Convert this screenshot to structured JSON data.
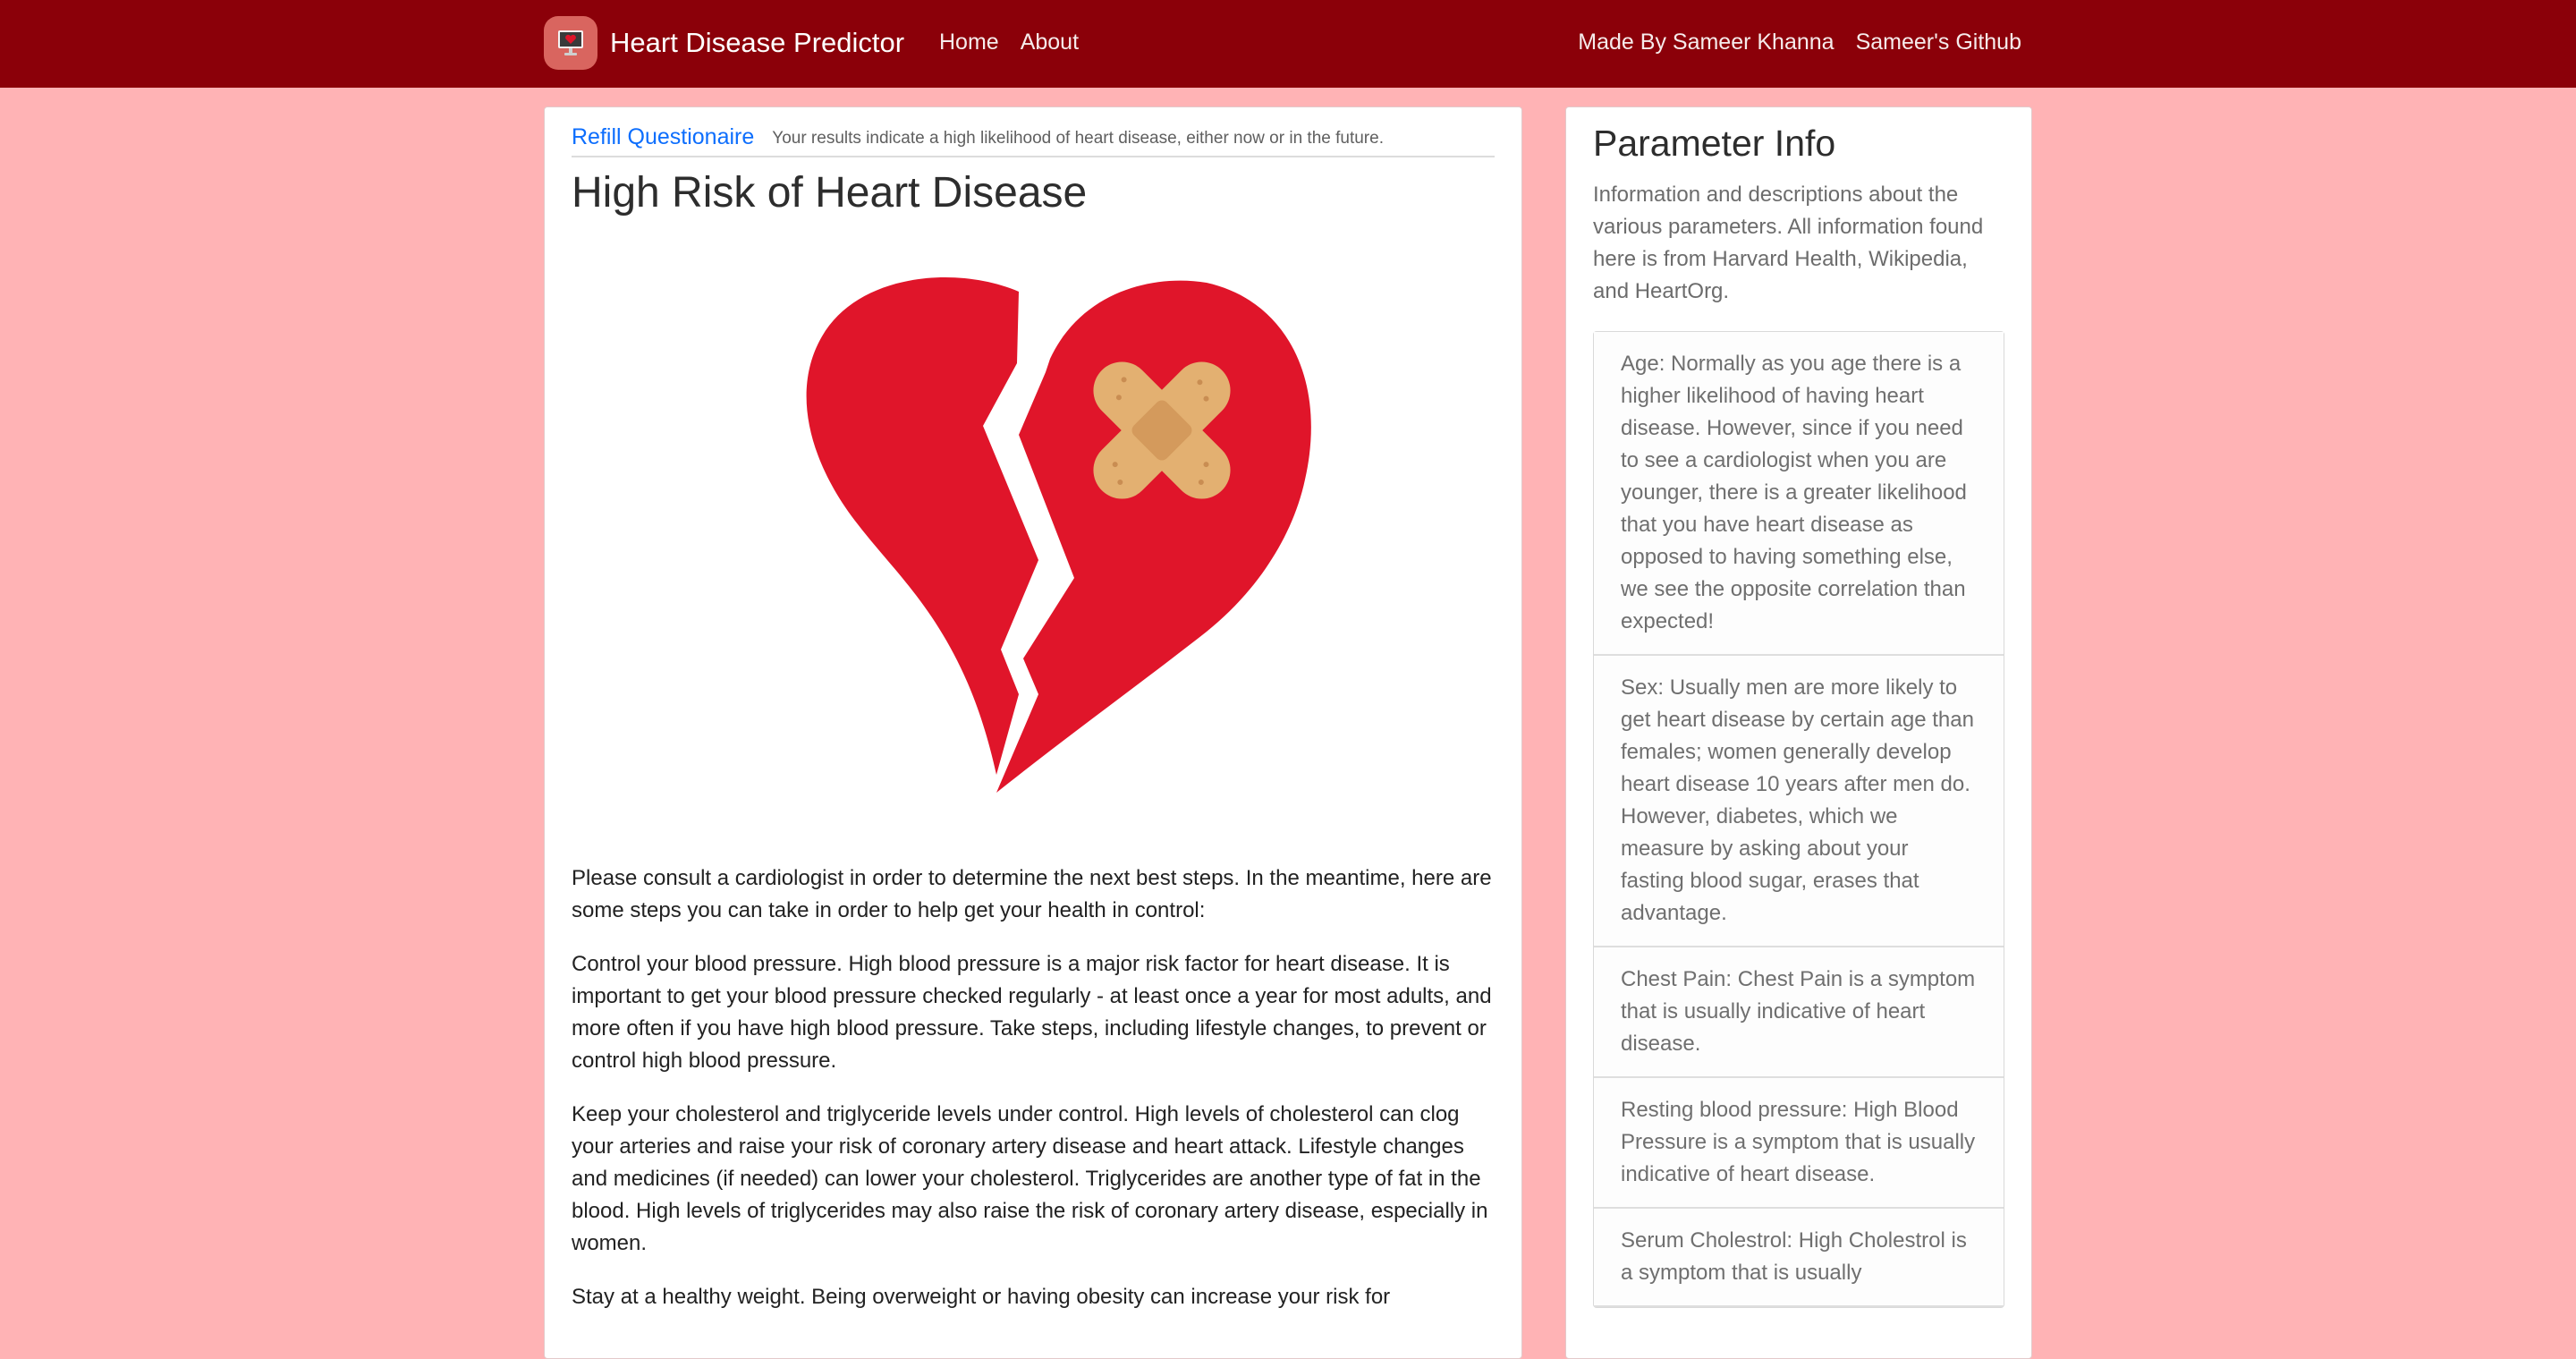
{
  "navbar": {
    "brand_title": "Heart Disease Predictor",
    "brand_logo_icon": "heart-monitor-icon",
    "links_left": [
      "Home",
      "About"
    ],
    "links_right": [
      "Made By Sameer Khanna",
      "Sameer's Github"
    ]
  },
  "result": {
    "refill_label": "Refill Questionaire",
    "header_note": "Your results indicate a high likelihood of heart disease, either now or in the future.",
    "title": "High Risk of Heart Disease",
    "image_icon": "broken-heart-bandage-icon",
    "paragraphs": [
      "Please consult a cardiologist in order to determine the next best steps. In the meantime, here are some steps you can take in order to help get your health in control:",
      "Control your blood pressure. High blood pressure is a major risk factor for heart disease. It is important to get your blood pressure checked regularly - at least once a year for most adults, and more often if you have high blood pressure. Take steps, including lifestyle changes, to prevent or control high blood pressure.",
      "Keep your cholesterol and triglyceride levels under control. High levels of cholesterol can clog your arteries and raise your risk of coronary artery disease and heart attack. Lifestyle changes and medicines (if needed) can lower your cholesterol. Triglycerides are another type of fat in the blood. High levels of triglycerides may also raise the risk of coronary artery disease, especially in women.",
      "Stay at a healthy weight. Being overweight or having obesity can increase your risk for"
    ]
  },
  "sidebar": {
    "title": "Parameter Info",
    "description": "Information and descriptions about the various parameters. All information found here is from Harvard Health, Wikipedia, and HeartOrg.",
    "params": [
      "Age: Normally as you age there is a higher likelihood of having heart disease. However, since if you need to see a cardiologist when you are younger, there is a greater likelihood that you have heart disease as opposed to having something else, we see the opposite correlation than expected!",
      "Sex: Usually men are more likely to get heart disease by certain age than females; women generally develop heart disease 10 years after men do. However, diabetes, which we measure by asking about your fasting blood sugar, erases that advantage.",
      "Chest Pain: Chest Pain is a symptom that is usually indicative of heart disease.",
      "Resting blood pressure: High Blood Pressure is a symptom that is usually indicative of heart disease.",
      "Serum Cholestrol: High Cholestrol is a symptom that is usually"
    ]
  },
  "colors": {
    "navbar": "#8b0009",
    "page_background": "#ffb3b5",
    "link": "#0d6efd",
    "heart": "#e0152a",
    "bandage": "#e3b071"
  }
}
